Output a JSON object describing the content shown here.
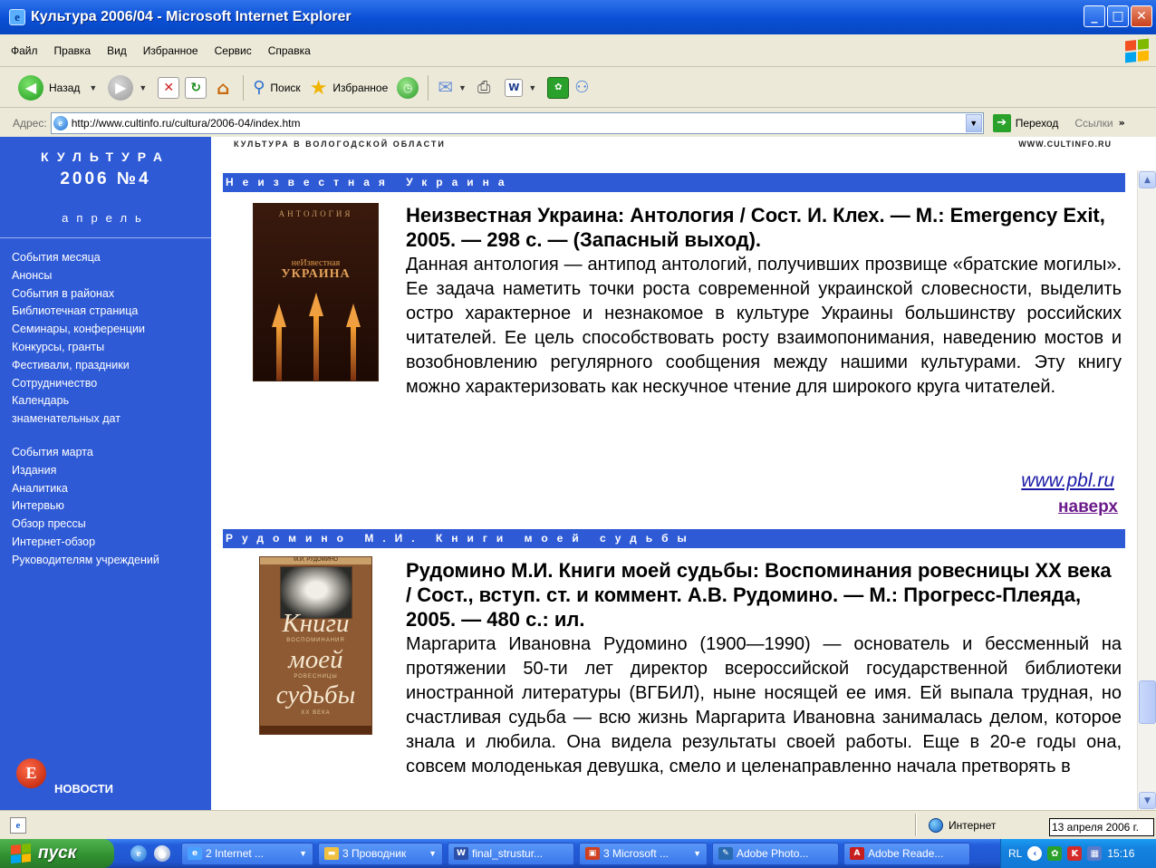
{
  "window": {
    "title": "Культура 2006/04 - Microsoft Internet Explorer",
    "buttons": {
      "minimize": "_",
      "maximize": "□",
      "close": "✕"
    }
  },
  "menu": [
    "Файл",
    "Правка",
    "Вид",
    "Избранное",
    "Сервис",
    "Справка"
  ],
  "toolbar": {
    "back_label": "Назад",
    "search_label": "Поиск",
    "favorites_label": "Избранное"
  },
  "address_bar": {
    "label": "Адрес:",
    "url": "http://www.cultinfo.ru/cultura/2006-04/index.htm",
    "go_label": "Переход",
    "links_label": "Ссылки"
  },
  "sidebar": {
    "title": "КУЛЬТУРА",
    "issue": "2006 №4",
    "month": "апрель",
    "nav_group1": [
      "События месяца",
      "Анонсы",
      "События в районах",
      "Библиотечная страница",
      "Семинары, конференции",
      "Конкурсы, гранты",
      "Фестивали, праздники",
      "Сотрудничество",
      "Календарь",
      "знаменательных дат"
    ],
    "nav_group2": [
      "События марта",
      "Издания",
      "Аналитика",
      "Интервью",
      "Обзор прессы",
      "Интернет-обзор",
      "Руководителям учреждений"
    ],
    "news_label": "НОВОСТИ"
  },
  "content": {
    "header_left": "КУЛЬТУРА В ВОЛОГОДСКОЙ ОБЛАСТИ",
    "header_right": "WWW.CULTINFO.RU",
    "articles": [
      {
        "section": "Неизвестная Украина",
        "title": "Неизвестная Украина: Антология / Сост. И. Клех. — М.: Emergency Exit, 2005. — 298 с. — (Запасный выход).",
        "description": "Данная антология — антипод антологий, получивших прозвище «братские могилы». Ее задача наметить точки роста современной украинской словесности, выделить остро характерное и незнакомое в культуре Украины большинству российских читателей. Ее цель способствовать росту взаимопонимания, наведению мостов и возобновлению регулярного сообщения между нашими культурами. Эту книгу можно характеризовать как нескучное чтение для широкого круга читателей.",
        "link": "www.pbl.ru",
        "top_link": "наверх",
        "cover": {
          "top": "АНТОЛОГИЯ",
          "line1": "неИзвестная",
          "line2": "УКРАИНА"
        }
      },
      {
        "section": "Рудомино М.И. Книги моей судьбы",
        "title": "Рудомино М.И. Книги моей судьбы: Воспоминания ровесницы XX века / Сост., вступ. ст. и коммент. А.В. Рудомино. — М.: Прогресс-Плеяда, 2005. — 480 с.: ил.",
        "description": "Маргарита Ивановна Рудомино (1900—1990) — основатель и бессменный на протяжении 50-ти лет директор всероссийской государственной библиотеки иностранной литературы (ВГБИЛ), ныне носящей ее имя. Ей выпала трудная, но счастливая судьба — всю жизнь Маргарита Ивановна занималась делом, которое знала и любила. Она видела результаты своей работы. Еще в 20-е годы она, совсем молоденькая девушка, смело и целенаправленно начала претворять в",
        "cover": {
          "band": "М.И. РУДОМИНО",
          "w1": "Книги",
          "s1": "ВОСПОМИНАНИЯ",
          "w2": "моей",
          "s2": "РОВЕСНИЦЫ",
          "w3": "судьбы",
          "s3": "XX ВЕКА"
        }
      }
    ]
  },
  "statusbar": {
    "zone": "Интернет",
    "date": "13 апреля 2006 г."
  },
  "taskbar": {
    "start_label": "пуск",
    "tasks": [
      "2 Internet ...",
      "3 Проводник",
      "final_strustur...",
      "3 Microsoft ...",
      "Adobe Photo...",
      "Adobe Reade..."
    ],
    "lang": "RL",
    "time": "15:16"
  },
  "colors": {
    "sidebar_bg": "#2f5ad6",
    "section_bar": "#2f5ad6",
    "link": "#1a1aa6",
    "visited_link": "#6a1a8a",
    "titlebar": "#0a4fd6"
  }
}
